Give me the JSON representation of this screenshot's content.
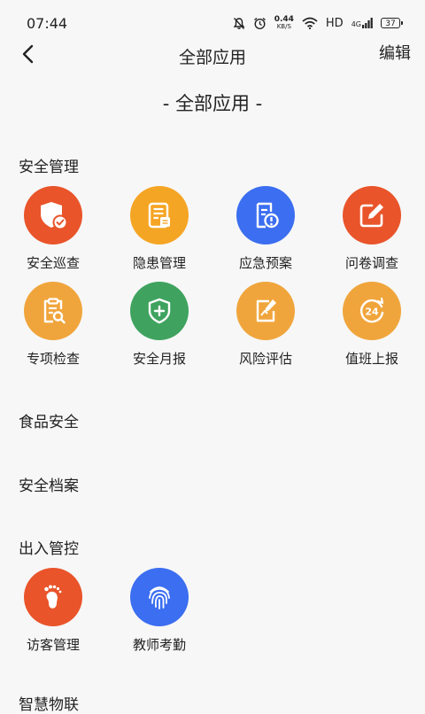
{
  "status_bar": {
    "time": "07:44",
    "net_speed_value": "0.44",
    "net_speed_unit": "KB/S",
    "hd": "HD",
    "signal": "4G",
    "battery": "37"
  },
  "nav": {
    "title": "全部应用",
    "edit_label": "编辑"
  },
  "section_header": "- 全部应用 -",
  "categories": {
    "safety": {
      "title": "安全管理",
      "apps": [
        {
          "label": "安全巡查",
          "icon": "shield-check-icon",
          "color": "#e9542a"
        },
        {
          "label": "隐患管理",
          "icon": "document-list-icon",
          "color": "#f5a524"
        },
        {
          "label": "应急预案",
          "icon": "document-alert-icon",
          "color": "#3b6ef0"
        },
        {
          "label": "问卷调查",
          "icon": "edit-square-icon",
          "color": "#e9542a"
        },
        {
          "label": "专项检查",
          "icon": "clipboard-search-icon",
          "color": "#f0a53c"
        },
        {
          "label": "安全月报",
          "icon": "shield-plus-icon",
          "color": "#3fa35f"
        },
        {
          "label": "风险评估",
          "icon": "pen-chart-icon",
          "color": "#f0a53c"
        },
        {
          "label": "值班上报",
          "icon": "clock-24-icon",
          "color": "#f0a53c"
        }
      ]
    },
    "food": {
      "title": "食品安全"
    },
    "archive": {
      "title": "安全档案"
    },
    "access": {
      "title": "出入管控",
      "apps": [
        {
          "label": "访客管理",
          "icon": "footprint-icon",
          "color": "#e9542a"
        },
        {
          "label": "教师考勤",
          "icon": "fingerprint-icon",
          "color": "#3b6ef0"
        }
      ]
    },
    "iot": {
      "title": "智慧物联"
    }
  }
}
